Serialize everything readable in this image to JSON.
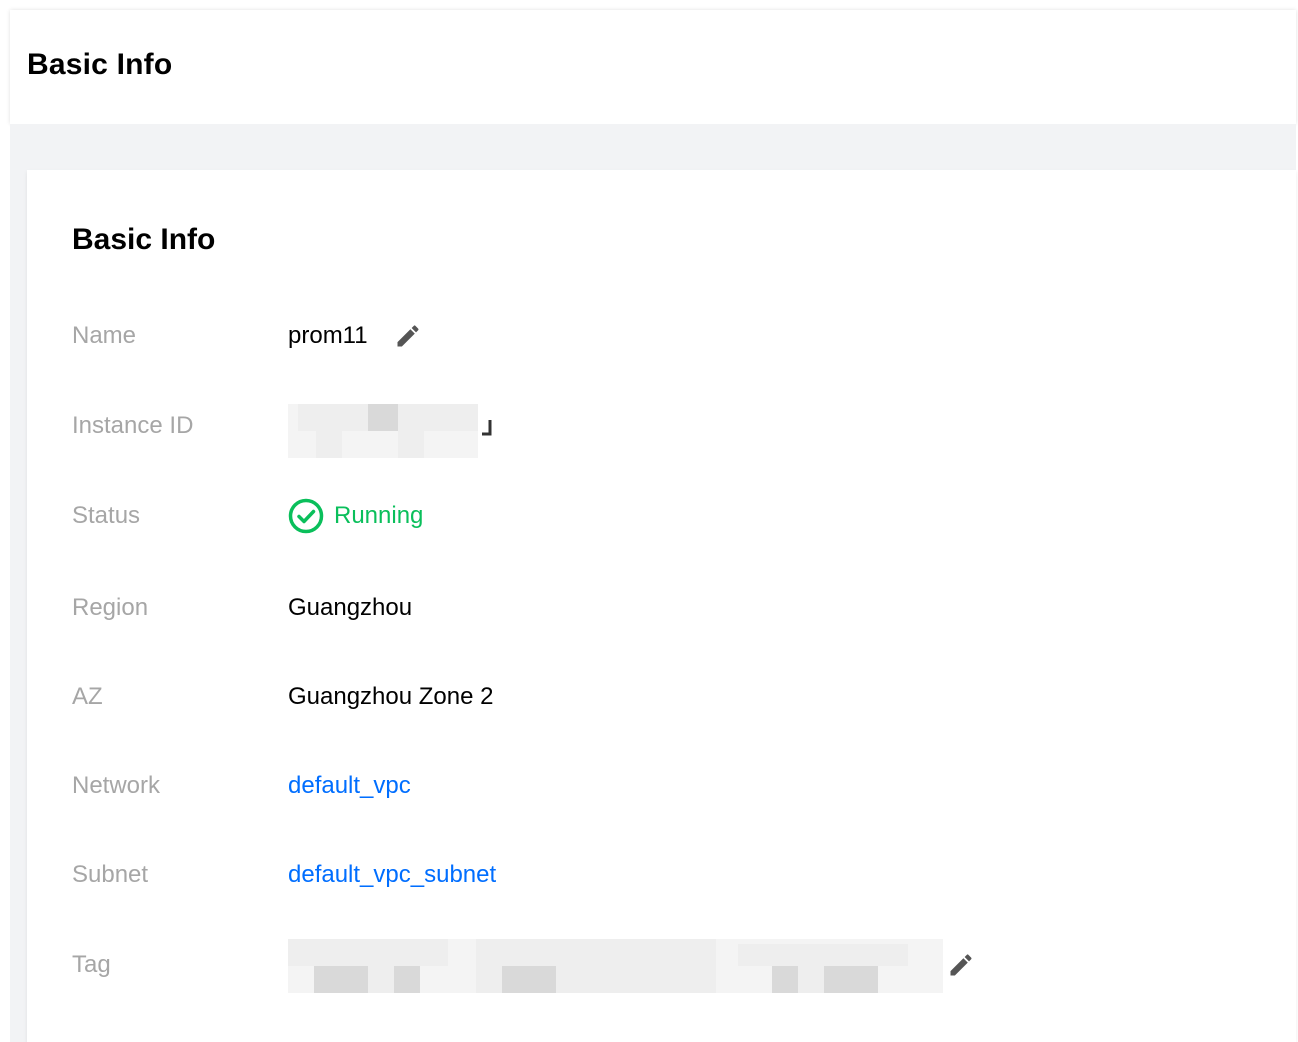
{
  "header": {
    "title": "Basic Info"
  },
  "card": {
    "title": "Basic Info",
    "fields": {
      "name": {
        "label": "Name",
        "value": "prom11"
      },
      "instance_id": {
        "label": "Instance ID"
      },
      "status": {
        "label": "Status",
        "value": "Running"
      },
      "region": {
        "label": "Region",
        "value": "Guangzhou"
      },
      "az": {
        "label": "AZ",
        "value": "Guangzhou Zone 2"
      },
      "network": {
        "label": "Network",
        "value": "default_vpc"
      },
      "subnet": {
        "label": "Subnet",
        "value": "default_vpc_subnet"
      },
      "tag": {
        "label": "Tag"
      }
    }
  },
  "icons": {
    "edit": "pencil-icon",
    "copy": "copy-icon",
    "status": "check-circle-icon"
  },
  "colors": {
    "link": "#006eff",
    "success": "#0abf5b",
    "label": "#a6a6a6",
    "background": "#f2f3f5"
  }
}
